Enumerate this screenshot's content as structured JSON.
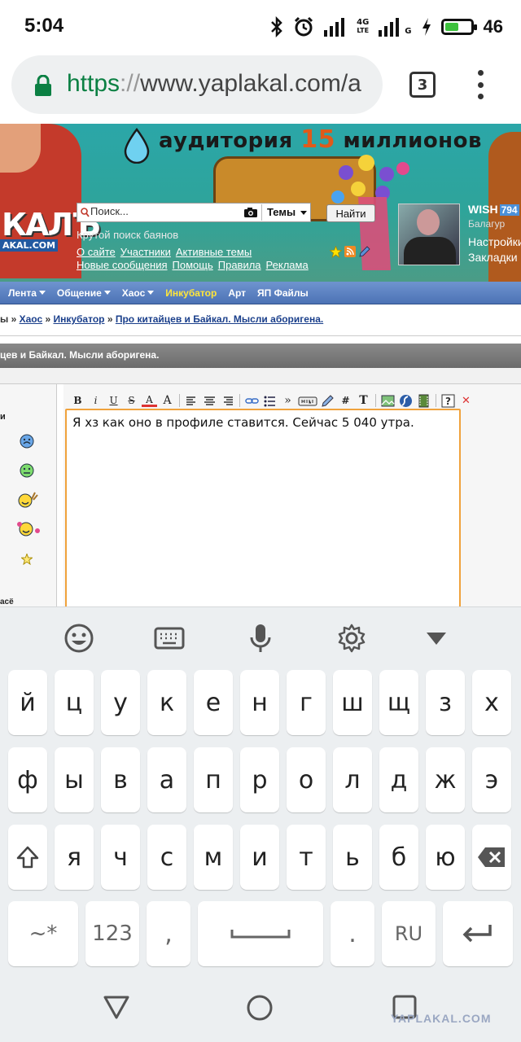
{
  "status_bar": {
    "time": "5:04",
    "network_4g": "4G",
    "network_lte": "LTE",
    "network_g": "G",
    "battery_percent": "46",
    "battery_level": 0.46,
    "accent_color": "#3cc13c"
  },
  "browser": {
    "url_scheme": "https",
    "url_separator": "://",
    "url_host": "www.yaplakal.com/a",
    "tab_count": "3",
    "icons": [
      "lock-icon",
      "tabs-icon",
      "overflow-menu-icon"
    ]
  },
  "banner": {
    "headline_pre": "аудитория",
    "headline_num": "15",
    "headline_post": "миллионов",
    "logo_text": "КАЛЪ",
    "logo_small": "AKAL.COM"
  },
  "header": {
    "search_placeholder": "Поиск...",
    "topics_label": "Темы",
    "find_button": "Найти",
    "tagline": "Крутой поиск баянов",
    "links_row1": [
      "О сайте",
      "Участники",
      "Активные темы"
    ],
    "links_row2": [
      "Новые сообщения",
      "Помощь",
      "Правила",
      "Реклама"
    ]
  },
  "user": {
    "name": "WISH",
    "badge": "794",
    "rank": "Балагур",
    "settings_link": "Настройки",
    "bookmarks_link": "Закладки"
  },
  "nav": {
    "items": [
      {
        "label": "Лента",
        "dropdown": true,
        "active": false
      },
      {
        "label": "Общение",
        "dropdown": true,
        "active": false
      },
      {
        "label": "Хаос",
        "dropdown": true,
        "active": false
      },
      {
        "label": "Инкубатор",
        "dropdown": false,
        "active": true
      },
      {
        "label": "Арт",
        "dropdown": false,
        "active": false
      },
      {
        "label": "ЯП Файлы",
        "dropdown": false,
        "active": false
      }
    ]
  },
  "breadcrumb": {
    "lead": "ы",
    "items": [
      "Хаос",
      "Инкубатор",
      "Про китайцев и Байкал. Мысли аборигена."
    ],
    "separator": " » "
  },
  "topic_title": "цев и Байкал. Мысли аборигена.",
  "left_panel": {
    "label": "и",
    "bottom_label": "асё",
    "smileys": [
      "crying-smiley-icon",
      "sick-smiley-icon",
      "peace-smiley-icon",
      "flower-smiley-icon",
      "star-smiley-icon"
    ]
  },
  "editor": {
    "toolbar_icons": [
      "bold-icon",
      "italic-icon",
      "underline-icon",
      "strike-icon",
      "font-color-icon",
      "font-size-icon",
      "align-left-icon",
      "align-center-icon",
      "align-right-icon",
      "link-icon",
      "list-icon",
      "quote-icon",
      "hide-icon",
      "edit-icon",
      "hash-icon",
      "text-icon",
      "image-icon",
      "flash-icon",
      "video-icon",
      "help-icon",
      "close-icon"
    ],
    "text": "Я хз как оно в профиле ставится. Сейчас 5 040 утра."
  },
  "keyboard": {
    "row1": [
      "й",
      "ц",
      "у",
      "к",
      "е",
      "н",
      "г",
      "ш",
      "щ",
      "з",
      "х"
    ],
    "row2": [
      "ф",
      "ы",
      "в",
      "а",
      "п",
      "р",
      "о",
      "л",
      "д",
      "ж",
      "э"
    ],
    "row3": [
      "я",
      "ч",
      "с",
      "м",
      "и",
      "т",
      "ь",
      "б",
      "ю"
    ],
    "symbols_key": "~*",
    "numbers_key": "123",
    "comma_key": ",",
    "period_key": ".",
    "language_key": "RU",
    "toolbar_icons": [
      "emoji-icon",
      "keyboard-icon",
      "microphone-icon",
      "settings-icon",
      "collapse-icon"
    ]
  },
  "watermark": "YAPLAKAL.COM"
}
